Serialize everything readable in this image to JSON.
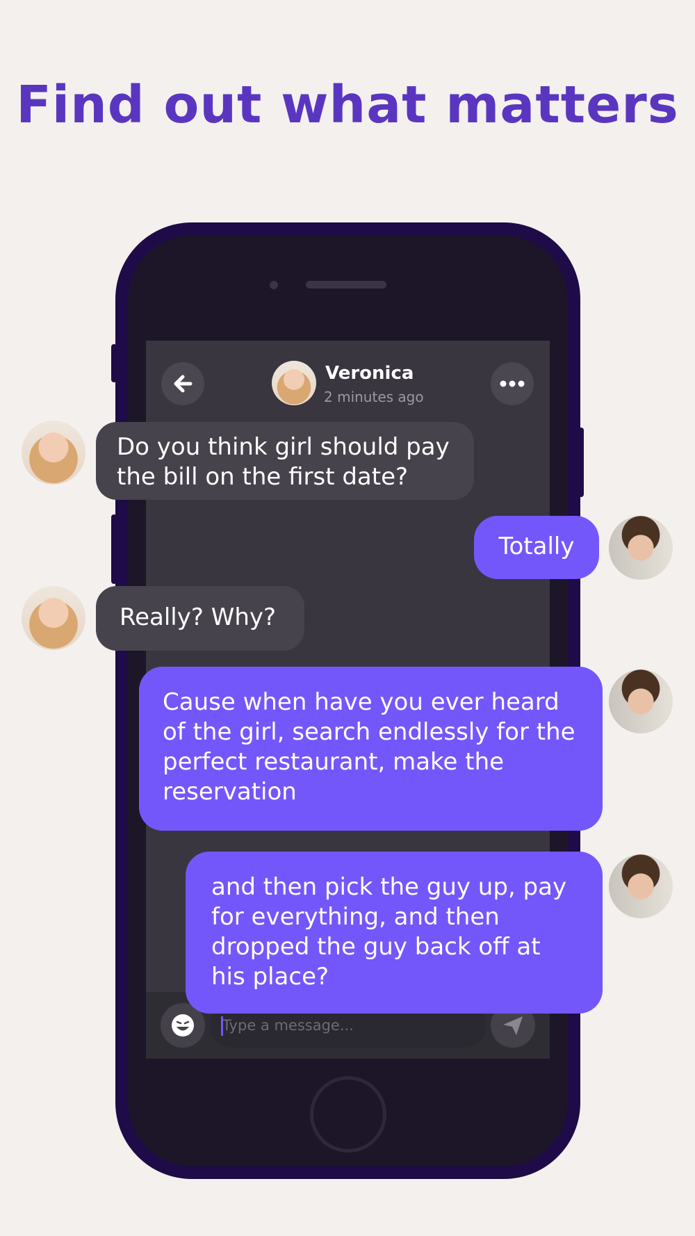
{
  "headline": "Find out what matters",
  "chat_header": {
    "contact_name": "Veronica",
    "last_seen": "2 minutes ago",
    "back_icon": "arrow-left-icon",
    "more_icon": "more-horizontal-icon"
  },
  "messages": [
    {
      "from": "them",
      "text": "Do you think girl should pay the bill on the first date?"
    },
    {
      "from": "me",
      "text": "Totally"
    },
    {
      "from": "them",
      "text": "Really? Why?"
    },
    {
      "from": "me",
      "text": "Cause when have you ever heard of the girl, search endlessly for the perfect restaurant, make the reservation"
    },
    {
      "from": "me",
      "text": "and then pick the guy up, pay for everything, and then dropped the guy back off at his place?"
    }
  ],
  "composer": {
    "placeholder": "Type a message...",
    "emoji_icon": "smiley-icon",
    "send_icon": "send-icon"
  },
  "colors": {
    "background": "#f4f0ee",
    "headline": "#5a36c0",
    "phone_frame": "#1f0b47",
    "screen": "#393640",
    "incoming_bubble": "#46434c",
    "outgoing_bubble": "#7457fa"
  }
}
